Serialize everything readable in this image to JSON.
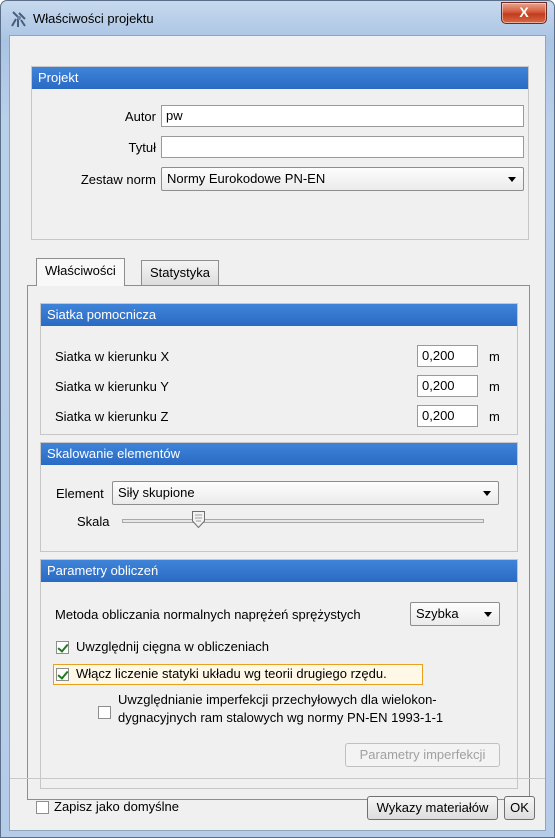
{
  "window": {
    "title": "Właściwości projektu",
    "close_glyph": "X"
  },
  "project": {
    "header": "Projekt",
    "author_label": "Autor",
    "author_value": "pw",
    "title_label": "Tytuł",
    "title_value": "",
    "norms_label": "Zestaw norm",
    "norms_value": "Normy Eurokodowe PN-EN"
  },
  "tabs": [
    {
      "label": "Właściwości",
      "active": true
    },
    {
      "label": "Statystyka",
      "active": false
    }
  ],
  "grid": {
    "header": "Siatka pomocnicza",
    "rows": [
      {
        "label": "Siatka w kierunku X",
        "value": "0,200",
        "unit": "m"
      },
      {
        "label": "Siatka w kierunku Y",
        "value": "0,200",
        "unit": "m"
      },
      {
        "label": "Siatka w kierunku Z",
        "value": "0,200",
        "unit": "m"
      }
    ]
  },
  "scaling": {
    "header": "Skalowanie elementów",
    "element_label": "Element",
    "element_value": "Siły skupione",
    "scale_label": "Skala",
    "scale_level": 0.2
  },
  "calc": {
    "header": "Parametry obliczeń",
    "method_label": "Metoda obliczania normalnych naprężeń sprężystych",
    "method_value": "Szybka",
    "cables_label": "Uwzględnij cięgna w obliczeniach",
    "cables_checked": true,
    "second_order_label": "Włącz liczenie statyki układu wg teorii drugiego rzędu.",
    "second_order_checked": true,
    "imperfection_label_1": "Uwzględnianie imperfekcji przechyłowych dla wielokon-",
    "imperfection_label_2": "dygnacyjnych ram stalowych wg normy PN-EN 1993-1-1",
    "imperfection_checked": false,
    "imperfection_button": "Parametry imperfekcji"
  },
  "footer": {
    "save_default_label": "Zapisz jako domyślne",
    "materials_button": "Wykazy materiałów",
    "ok_button": "OK"
  }
}
